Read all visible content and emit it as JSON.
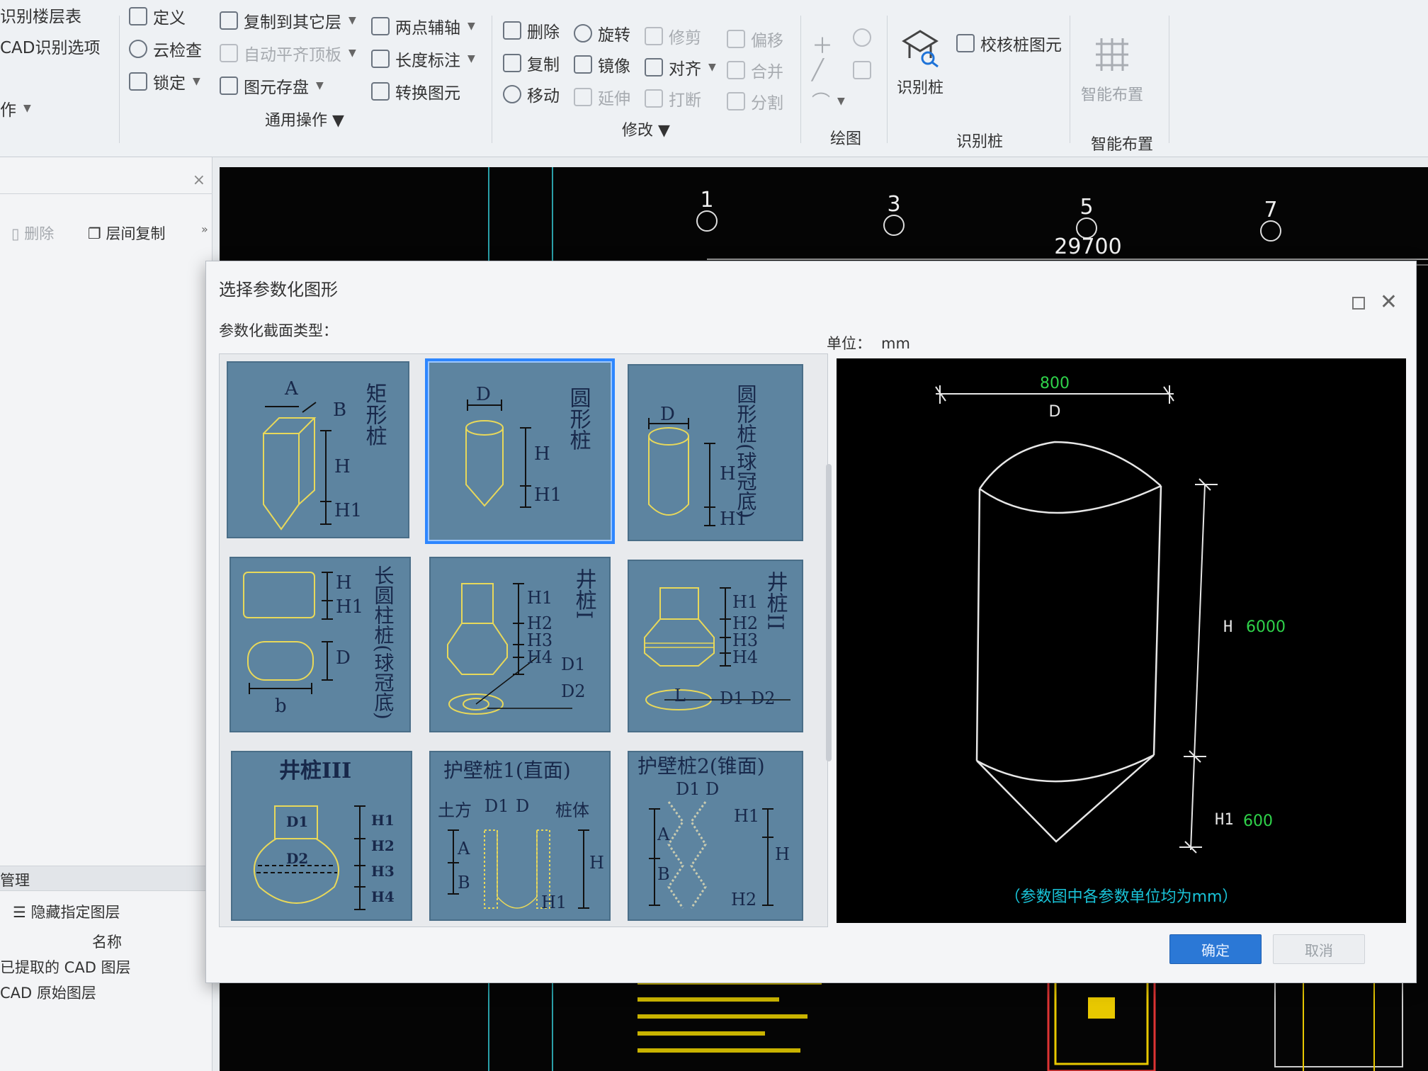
{
  "ribbon": {
    "col0": {
      "item1": "识别楼层表",
      "item2": "CAD识别选项",
      "item3": "作"
    },
    "general": {
      "define": "定义",
      "cloud_check": "云检查",
      "lock": "锁定",
      "copy_to_floor": "复制到其它层",
      "auto_flush": "自动平齐顶板",
      "save_element": "图元存盘",
      "two_point_aux": "两点辅轴",
      "length_dim": "长度标注",
      "convert_element": "转换图元",
      "group_label": "通用操作"
    },
    "modify": {
      "delete": "删除",
      "rotate": "旋转",
      "trim": "修剪",
      "offset": "偏移",
      "copy": "复制",
      "mirror": "镜像",
      "align": "对齐",
      "merge": "合并",
      "move": "移动",
      "extend": "延伸",
      "break": "打断",
      "split": "分割",
      "group_label": "修改"
    },
    "draw": {
      "group_label": "绘图"
    },
    "recognize": {
      "identify_pile": "识别桩",
      "check_pile": "校核桩图元",
      "group_label": "识别桩"
    },
    "smart": {
      "smart_layout": "智能布置",
      "group_label": "智能布置"
    }
  },
  "left_panel": {
    "delete": "删除",
    "floor_copy": "层间复制",
    "manage": "管理",
    "hide_layers": "隐藏指定图层",
    "name_header": "名称",
    "layer_extracted": "已提取的 CAD 图层",
    "layer_original": "CAD 原始图层"
  },
  "cad": {
    "axes": [
      "1",
      "3",
      "5",
      "7"
    ],
    "dimension": "29700"
  },
  "dialog": {
    "title": "选择参数化图形",
    "section_type_label": "参数化截面类型：",
    "unit_label": "单位：",
    "unit_value": "mm",
    "tiles": [
      {
        "name": "矩形桩",
        "labels": [
          "A",
          "B",
          "H",
          "H1"
        ]
      },
      {
        "name": "圆形桩",
        "labels": [
          "D",
          "H",
          "H1"
        ],
        "selected": true
      },
      {
        "name": "圆形桩(球冠底)",
        "labels": [
          "D",
          "H",
          "H1"
        ]
      },
      {
        "name": "长圆柱桩(球冠底)",
        "labels": [
          "H",
          "H1",
          "D",
          "b"
        ]
      },
      {
        "name": "井桩I",
        "labels": [
          "H1",
          "H2",
          "H3",
          "H4",
          "D1",
          "D2"
        ]
      },
      {
        "name": "井桩II",
        "labels": [
          "H1",
          "H2",
          "H3",
          "H4",
          "L",
          "D1",
          "D2"
        ]
      },
      {
        "name": "井桩III",
        "labels": [
          "D1",
          "D2",
          "H1",
          "H2",
          "H3",
          "H4"
        ]
      },
      {
        "name": "护壁桩1(直面)",
        "labels": [
          "土方",
          "D1",
          "D",
          "桩体",
          "A",
          "B",
          "H",
          "H1"
        ]
      },
      {
        "name": "护壁桩2(锥面)",
        "labels": [
          "D1",
          "D",
          "A",
          "B",
          "H1",
          "H",
          "H2"
        ]
      }
    ],
    "preview": {
      "D_value": "800",
      "D_label": "D",
      "H_label": "H",
      "H_value": "6000",
      "H1_label": "H1",
      "H1_value": "600",
      "note": "（参数图中各参数单位均为mm）"
    },
    "ok_label": "确定",
    "cancel_label": "取消"
  },
  "colors": {
    "tile_bg": "#5d84a0",
    "tile_selected_border": "#2d86ff",
    "param_value": "#2fd24a",
    "note_text": "#19c3d8",
    "ok_button": "#2b78d6"
  }
}
